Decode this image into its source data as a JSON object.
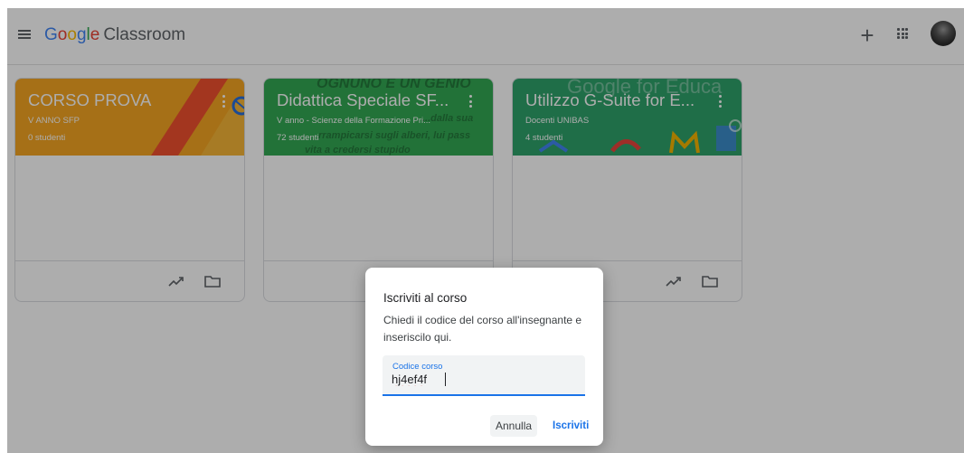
{
  "header": {
    "logo_google": [
      "G",
      "o",
      "o",
      "g",
      "l",
      "e"
    ],
    "product_name": "Classroom",
    "plus_symbol": "+"
  },
  "courses": [
    {
      "title": "CORSO PROVA",
      "section": "V ANNO SFP",
      "students": "0 studenti",
      "theme_color": "#f5a623"
    },
    {
      "title": "Didattica Speciale SF...",
      "section": "V anno - Scienze della Formazione Pri...",
      "students": "72 studenti",
      "theme_color": "#33a853",
      "banner_text": [
        "OGNUNO È UN GENIO",
        "...dalla sua",
        "rrampicarsi sugli alberi, lui pass",
        "vita a credersi stupido"
      ]
    },
    {
      "title": "Utilizzo G-Suite for E...",
      "section": "Docenti UNIBAS",
      "students": "4 studenti",
      "theme_color": "#2ea26b",
      "banner_text": [
        "Google for Educa"
      ]
    }
  ],
  "icons": {
    "menu": "hamburger-menu-icon",
    "create": "plus-icon",
    "apps": "apps-grid-icon",
    "card_menu": "more-vert-icon",
    "trend": "trending-up-icon",
    "folder": "folder-icon"
  },
  "dialog": {
    "title": "Iscriviti al corso",
    "description": "Chiedi il codice del corso all'insegnante e inseriscilo qui.",
    "field_label": "Codice corso",
    "field_value": "hj4ef4f",
    "cancel_label": "Annulla",
    "join_label": "Iscriviti"
  },
  "colors": {
    "accent": "#1a73e8",
    "overlay": "rgba(0,0,0,0.32)"
  }
}
